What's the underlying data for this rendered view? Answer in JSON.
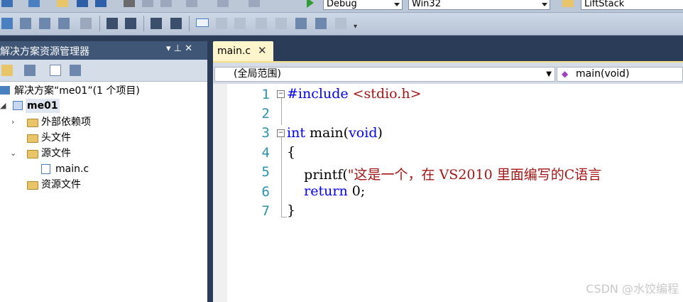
{
  "toolbar": {
    "config": "Debug",
    "platform": "Win32",
    "find_text": "LiftStack"
  },
  "solution_explorer": {
    "title": "解决方案资源管理器",
    "pin": "▾ ⊥ ✕",
    "solution": "解决方案“me01”(1 个项目)",
    "project": "me01",
    "items": {
      "external": "外部依赖项",
      "headers": "头文件",
      "sources": "源文件",
      "main_file": "main.c",
      "resources": "资源文件"
    }
  },
  "editor": {
    "tab_label": "main.c",
    "tab_close": "✕",
    "scope": "(全局范围)",
    "member": "main(void)",
    "line_numbers": [
      "1",
      "2",
      "3",
      "4",
      "5",
      "6",
      "7"
    ],
    "code": {
      "l1_pp": "#include ",
      "l1_str": "<stdio.h>",
      "l3_kw": "int",
      "l3_rest": " main(",
      "l3_kw2": "void",
      "l3_end": ")",
      "l4": "{",
      "l5_fn": "    printf(",
      "l5_str": "\"这是一个，在 VS2010 里面编写的C语言",
      "l6_kw": "    return",
      "l6_rest": " 0;",
      "l7": "}"
    }
  },
  "watermark": "CSDN @水饺编程"
}
